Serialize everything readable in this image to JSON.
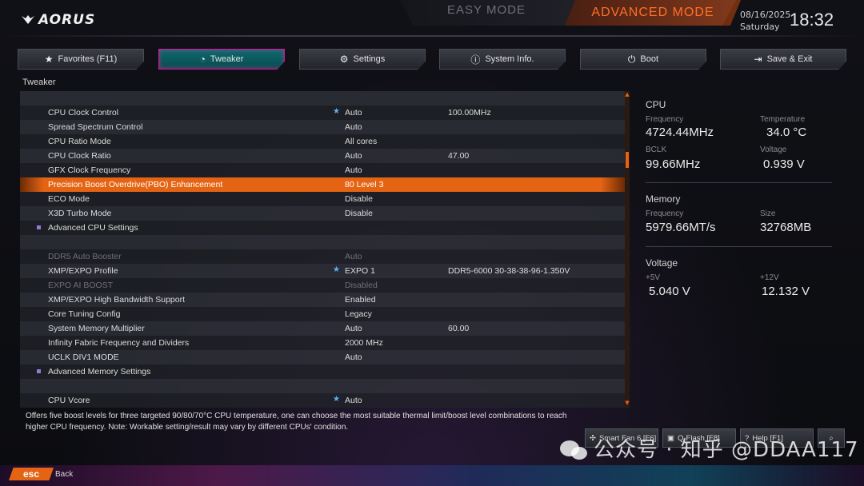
{
  "header": {
    "logo": "AORUS",
    "easy_mode": "EASY MODE",
    "advanced_mode": "ADVANCED MODE",
    "date": "08/16/2025",
    "day": "Saturday",
    "time": "18:32"
  },
  "tabs": [
    {
      "label": "Favorites (F11)",
      "icon": "star-folder-icon"
    },
    {
      "label": "Tweaker",
      "icon": "speedometer-icon"
    },
    {
      "label": "Settings",
      "icon": "gear-icon"
    },
    {
      "label": "System Info.",
      "icon": "info-icon"
    },
    {
      "label": "Boot",
      "icon": "power-icon"
    },
    {
      "label": "Save & Exit",
      "icon": "exit-icon"
    }
  ],
  "section_title": "Tweaker",
  "settings": [
    {
      "name": "",
      "value": "",
      "value2": ""
    },
    {
      "name": "CPU Clock Control",
      "value": "Auto",
      "value2": "100.00MHz",
      "starred": true
    },
    {
      "name": "Spread Spectrum Control",
      "value": "Auto",
      "value2": ""
    },
    {
      "name": "CPU Ratio Mode",
      "value": "All cores",
      "value2": ""
    },
    {
      "name": "CPU Clock Ratio",
      "value": "Auto",
      "value2": "47.00"
    },
    {
      "name": "GFX Clock Frequency",
      "value": "Auto",
      "value2": ""
    },
    {
      "name": "Precision Boost Overdrive(PBO) Enhancement",
      "value": "80 Level 3",
      "value2": "",
      "highlighted": true
    },
    {
      "name": "ECO Mode",
      "value": "Disable",
      "value2": ""
    },
    {
      "name": "X3D Turbo Mode",
      "value": "Disable",
      "value2": ""
    },
    {
      "name": "Advanced CPU Settings",
      "value": "",
      "value2": "",
      "submenu": true
    },
    {
      "name": "",
      "value": "",
      "value2": ""
    },
    {
      "name": "DDR5 Auto Booster",
      "value": "Auto",
      "value2": "",
      "dim": true
    },
    {
      "name": "XMP/EXPO Profile",
      "value": "EXPO 1",
      "value2": "DDR5-6000 30-38-38-96-1.350V",
      "starred": true
    },
    {
      "name": "EXPO AI BOOST",
      "value": "Disabled",
      "value2": "",
      "dim": true
    },
    {
      "name": "XMP/EXPO High Bandwidth Support",
      "value": "Enabled",
      "value2": ""
    },
    {
      "name": "Core Tuning Config",
      "value": "Legacy",
      "value2": ""
    },
    {
      "name": "System Memory Multiplier",
      "value": "Auto",
      "value2": "60.00"
    },
    {
      "name": "Infinity Fabric Frequency and Dividers",
      "value": "2000 MHz",
      "value2": ""
    },
    {
      "name": "UCLK DIV1 MODE",
      "value": "Auto",
      "value2": ""
    },
    {
      "name": "Advanced Memory Settings",
      "value": "",
      "value2": "",
      "submenu": true
    },
    {
      "name": "",
      "value": "",
      "value2": ""
    },
    {
      "name": "CPU Vcore",
      "value": "Auto",
      "value2": "",
      "starred": true
    }
  ],
  "info": {
    "cpu": {
      "title": "CPU",
      "frequency_label": "Frequency",
      "frequency": "4724.44MHz",
      "temperature_label": "Temperature",
      "temperature": "34.0 °C",
      "bclk_label": "BCLK",
      "bclk": "99.66MHz",
      "voltage_label": "Voltage",
      "voltage": "0.939 V"
    },
    "memory": {
      "title": "Memory",
      "frequency_label": "Frequency",
      "frequency": "5979.66MT/s",
      "size_label": "Size",
      "size": "32768MB"
    },
    "voltage": {
      "title": "Voltage",
      "p5v_label": "+5V",
      "p5v": "5.040 V",
      "p12v_label": "+12V",
      "p12v": "12.132 V"
    }
  },
  "help_text": "Offers five boost levels for three targeted 90/80/70°C CPU temperature, one can choose the most suitable thermal limit/boost level combinations to reach higher CPU frequency. Note: Workable setting/result may vary by different CPUs' condition.",
  "bottom_buttons": [
    {
      "label": "Smart Fan 6 [F6]",
      "icon": "fan-icon"
    },
    {
      "label": "Q-Flash [F8]",
      "icon": "flash-icon"
    },
    {
      "label": "Help [F1]",
      "icon": "help-icon"
    },
    {
      "label": "",
      "icon": "search-icon"
    }
  ],
  "watermark": "公众号 · 知乎 @DDAA117",
  "footer": {
    "esc": "esc",
    "back": "Back"
  }
}
